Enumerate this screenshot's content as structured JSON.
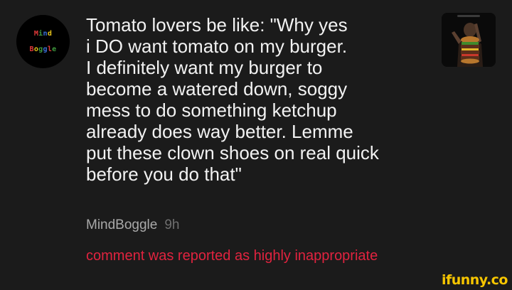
{
  "avatar": {
    "line1": [
      "M",
      "i",
      "n",
      "d"
    ],
    "line2": [
      "B",
      "o",
      "g",
      "g",
      "l",
      "e"
    ],
    "line1_colors": [
      "#e23a3a",
      "#3f9b3f",
      "#3b6fd8",
      "#e8c41a"
    ],
    "line2_colors": [
      "#e23a3a",
      "#e8c41a",
      "#3f9b3f",
      "#3b6fd8",
      "#e23a3a",
      "#3f9b3f"
    ]
  },
  "comment": {
    "text": "Tomato lovers be like: \"Why yes\ni DO want tomato on my burger.\nI definitely want my burger to\nbecome a watered down, soggy\nmess to do something ketchup\nalready does way better. Lemme\nput these clown shoes on real quick\nbefore you do that\"",
    "username": "MindBoggle",
    "timestamp": "9h",
    "report_notice": "comment was reported as highly inappropriate"
  },
  "thumbnail": {
    "icon": "burger-meme-image"
  },
  "watermark": {
    "text": "ifunny.co"
  },
  "colors": {
    "background": "#1b1b1b",
    "text": "#f2f2f2",
    "username": "#a9a9a9",
    "timestamp": "#6f6f6f",
    "report": "#e1233f",
    "watermark": "#f7c600"
  }
}
